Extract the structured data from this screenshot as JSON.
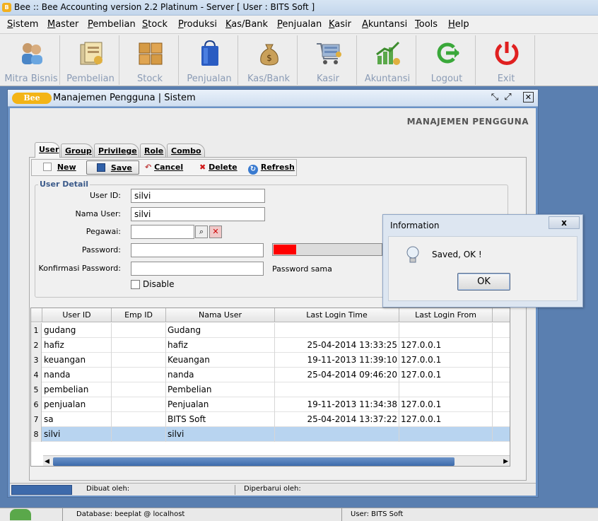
{
  "window": {
    "title": "Bee :: Bee Accounting version 2.2 Platinum - Server  [ User : BITS Soft ]"
  },
  "menu": [
    "Sistem",
    "Master",
    "Pembelian",
    "Stock",
    "Produksi",
    "Kas/Bank",
    "Penjualan",
    "Kasir",
    "Akuntansi",
    "Tools",
    "Help"
  ],
  "toolbar": [
    {
      "label": "Mitra Bisnis",
      "icon": "partners-icon"
    },
    {
      "label": "Pembelian",
      "icon": "purchase-icon"
    },
    {
      "label": "Stock",
      "icon": "stock-icon"
    },
    {
      "label": "Penjualan",
      "icon": "sales-bag-icon"
    },
    {
      "label": "Kas/Bank",
      "icon": "money-bag-icon"
    },
    {
      "label": "Kasir",
      "icon": "cashier-cart-icon"
    },
    {
      "label": "Akuntansi",
      "icon": "accounting-chart-icon"
    },
    {
      "label": "Logout",
      "icon": "logout-arrow-icon"
    },
    {
      "label": "Exit",
      "icon": "power-icon"
    }
  ],
  "frame": {
    "logo": "Bee",
    "title": "Manajemen Pengguna | Sistem",
    "page_title": "MANAJEMEN PENGGUNA"
  },
  "tabs": [
    "User",
    "Group",
    "Privilege",
    "Role",
    "Combo"
  ],
  "actions": {
    "new": "New",
    "save": "Save",
    "cancel": "Cancel",
    "delete": "Delete",
    "refresh": "Refresh"
  },
  "detail": {
    "legend": "User Detail",
    "user_id_label": "User ID:",
    "user_id": "silvi",
    "nama_user_label": "Nama User:",
    "nama_user": "silvi",
    "pegawai_label": "Pegawai:",
    "pegawai": "",
    "password_label": "Password:",
    "password": "",
    "password_strength": 0.21,
    "konfirmasi_label": "Konfirmasi Password:",
    "konfirmasi": "",
    "password_sama": "Password sama",
    "disable_label": "Disable"
  },
  "table": {
    "columns": [
      "User ID",
      "Emp ID",
      "Nama User",
      "Last Login Time",
      "Last Login From"
    ],
    "rows": [
      {
        "n": "1",
        "user_id": "gudang",
        "emp_id": "",
        "nama": "Gudang",
        "time": "",
        "from": ""
      },
      {
        "n": "2",
        "user_id": "hafiz",
        "emp_id": "",
        "nama": "hafiz",
        "time": "25-04-2014 13:33:25",
        "from": "127.0.0.1"
      },
      {
        "n": "3",
        "user_id": "keuangan",
        "emp_id": "",
        "nama": "Keuangan",
        "time": "19-11-2013 11:39:10",
        "from": "127.0.0.1"
      },
      {
        "n": "4",
        "user_id": "nanda",
        "emp_id": "",
        "nama": "nanda",
        "time": "25-04-2014 09:46:20",
        "from": "127.0.0.1"
      },
      {
        "n": "5",
        "user_id": "pembelian",
        "emp_id": "",
        "nama": "Pembelian",
        "time": "",
        "from": ""
      },
      {
        "n": "6",
        "user_id": "penjualan",
        "emp_id": "",
        "nama": "Penjualan",
        "time": "19-11-2013 11:34:38",
        "from": "127.0.0.1"
      },
      {
        "n": "7",
        "user_id": "sa",
        "emp_id": "",
        "nama": "BITS Soft",
        "time": "25-04-2014 13:37:22",
        "from": "127.0.0.1"
      },
      {
        "n": "8",
        "user_id": "silvi",
        "emp_id": "",
        "nama": "silvi",
        "time": "",
        "from": ""
      }
    ]
  },
  "status": {
    "dibuat": "Dibuat oleh:",
    "diperbarui": "Diperbarui oleh:"
  },
  "bottom": {
    "database": "Database: beeplat @ localhost",
    "user": "User: BITS Soft"
  },
  "dialog": {
    "title": "Information",
    "close": "x",
    "message": "Saved, OK !",
    "ok": "OK"
  }
}
